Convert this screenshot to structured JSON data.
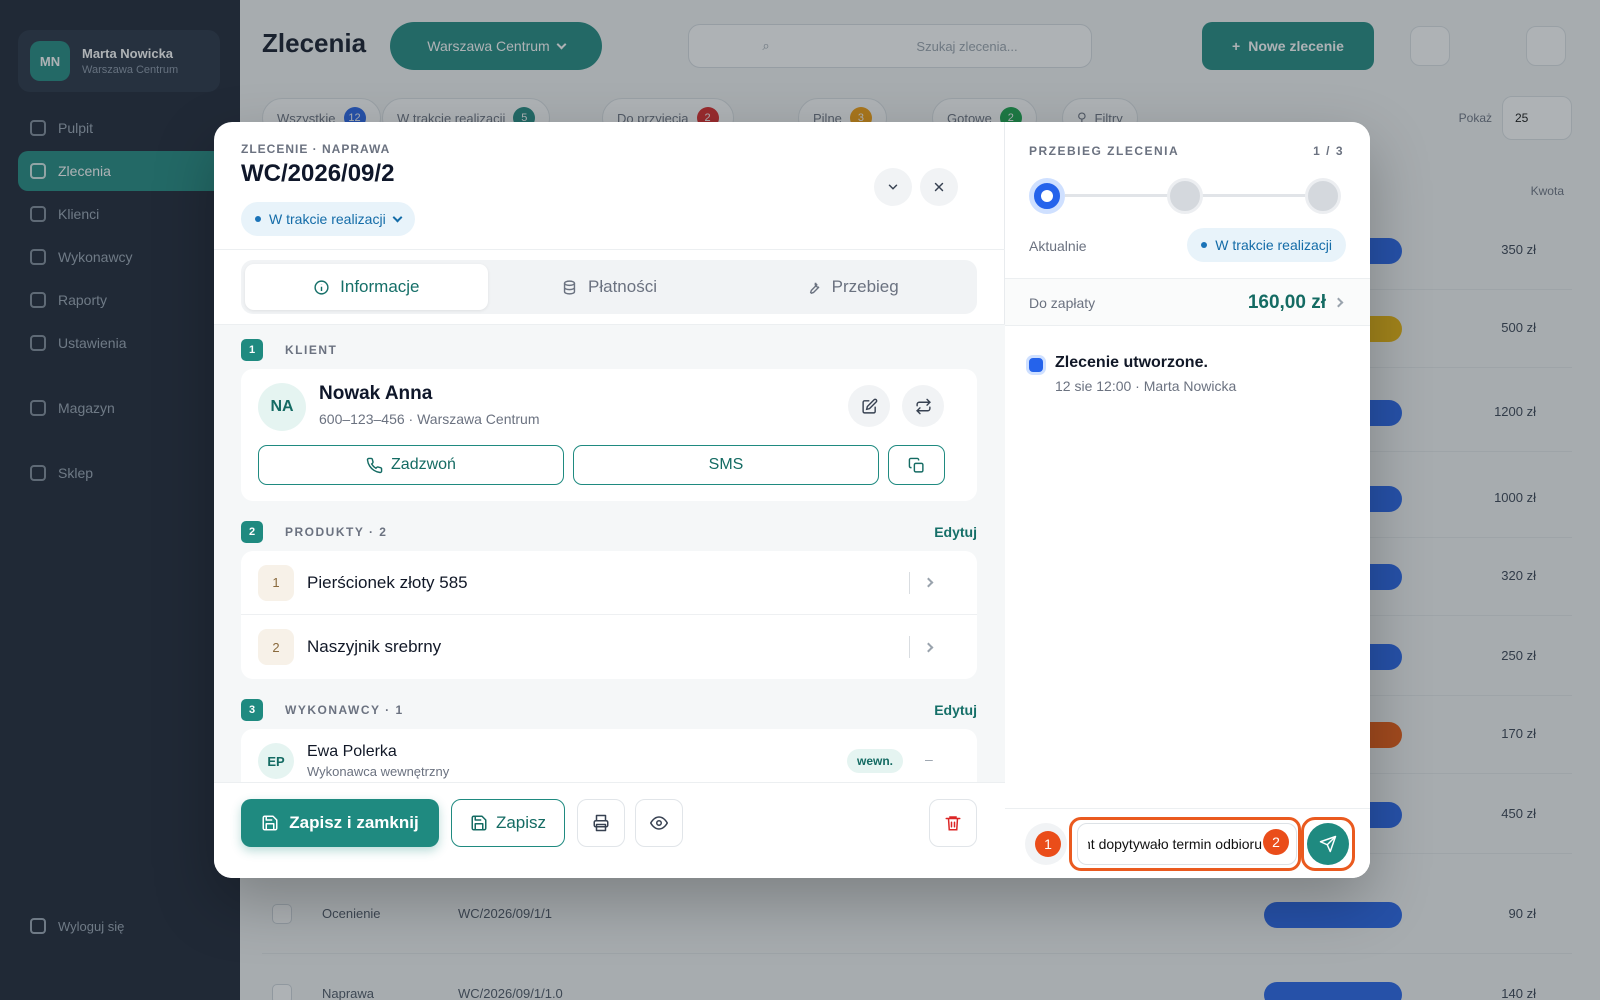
{
  "background": {
    "user": {
      "initials": "MN",
      "name": "Marta Nowicka",
      "role": "Warszawa Centrum"
    },
    "nav": [
      "Pulpit",
      "Zlecenia",
      "Klienci",
      "Wykonawcy",
      "Raporty",
      "Ustawienia",
      "Magazyn",
      "Sklep"
    ],
    "logout": "Wyloguj się",
    "title": "Zlecenia",
    "location": "Warszawa Centrum",
    "search_placeholder": "Szukaj zlecenia...",
    "new_order": "Nowe zlecenie",
    "filters": [
      {
        "label": "Wszystkie",
        "count": "12",
        "color": "#2563eb"
      },
      {
        "label": "W trakcie realizacji",
        "count": "5",
        "color": "#1f8a80"
      },
      {
        "label": "Do przyjęcia",
        "count": "2",
        "color": "#dc2626"
      },
      {
        "label": "Pilne",
        "count": "3",
        "color": "#f59e0b"
      },
      {
        "label": "Gotowe",
        "count": "2",
        "color": "#16a34a"
      },
      {
        "label": "Filtry",
        "count": "",
        "color": "#1f8a80"
      }
    ],
    "per_page_label": "Pokaż",
    "per_page_value": "25",
    "total_header": "Kwota",
    "rows": [
      {
        "amount": "350 zł",
        "badge": "#2563eb"
      },
      {
        "amount": "500 zł",
        "badge": "#eab308"
      },
      {
        "amount": "1200 zł",
        "badge": "#2563eb"
      },
      {
        "amount": "1000 zł",
        "badge": "#2563eb"
      },
      {
        "amount": "320 zł",
        "badge": "#2563eb"
      },
      {
        "amount": "250 zł",
        "badge": "#2563eb"
      },
      {
        "amount": "170 zł",
        "badge": "#ea580c"
      },
      {
        "amount": "450 zł",
        "badge": "#2563eb"
      },
      {
        "amount": "90 zł",
        "badge": "#2563eb",
        "type": "Ocenienie",
        "number": "WC/2026/09/1/1"
      },
      {
        "amount": "140 zł",
        "badge": "#2563eb",
        "type": "Naprawa",
        "number": "WC/2026/09/1/1.0"
      }
    ]
  },
  "modal": {
    "eyebrow": "ZLECENIE · NAPRAWA",
    "order_number": "WC/2026/09/2",
    "status": "W trakcie realizacji",
    "tabs": [
      {
        "label": "Informacje",
        "icon": "info-icon"
      },
      {
        "label": "Płatności",
        "icon": "coins-icon"
      },
      {
        "label": "Przebieg",
        "icon": "wrench-icon"
      }
    ],
    "client": {
      "num": "1",
      "section_title": "KLIENT",
      "initials": "NA",
      "name": "Nowak Anna",
      "details": "600–123–456 · Warszawa Centrum",
      "call": "Zadzwoń",
      "sms": "SMS"
    },
    "products": {
      "num": "2",
      "section_title": "PRODUKTY · 2",
      "edit": "Edytuj",
      "items": [
        {
          "num": "1",
          "name": "Pierścionek złoty 585"
        },
        {
          "num": "2",
          "name": "Naszyjnik srebrny"
        }
      ]
    },
    "contractors": {
      "num": "3",
      "section_title": "WYKONAWCY · 1",
      "edit": "Edytuj",
      "items": [
        {
          "initials": "EP",
          "name": "Ewa Polerka",
          "role": "Wykonawca wewnętrzny",
          "badge": "wewn.",
          "value": "–"
        }
      ]
    },
    "footer": {
      "save_close": "Zapisz i zamknij",
      "save": "Zapisz"
    }
  },
  "progress": {
    "title": "PRZEBIEG ZLECENIA",
    "count": "1 / 3",
    "steps_total": 3,
    "step_current": 1,
    "current_label": "Aktualnie",
    "current_status": "W trakcie realizacji",
    "due_label": "Do zapłaty",
    "due_value": "160,00 zł",
    "timeline": [
      {
        "title": "Zlecenie utworzone.",
        "meta": "12 sie 12:00 · Marta Nowicka"
      }
    ],
    "message_value": "Klient dopytywało termin odbioru",
    "markers": [
      "1",
      "2"
    ]
  },
  "colors": {
    "accent": "#1f8a80",
    "status_blue": "#146ca8",
    "highlight": "#ea5a1f",
    "danger": "#dc2626"
  }
}
